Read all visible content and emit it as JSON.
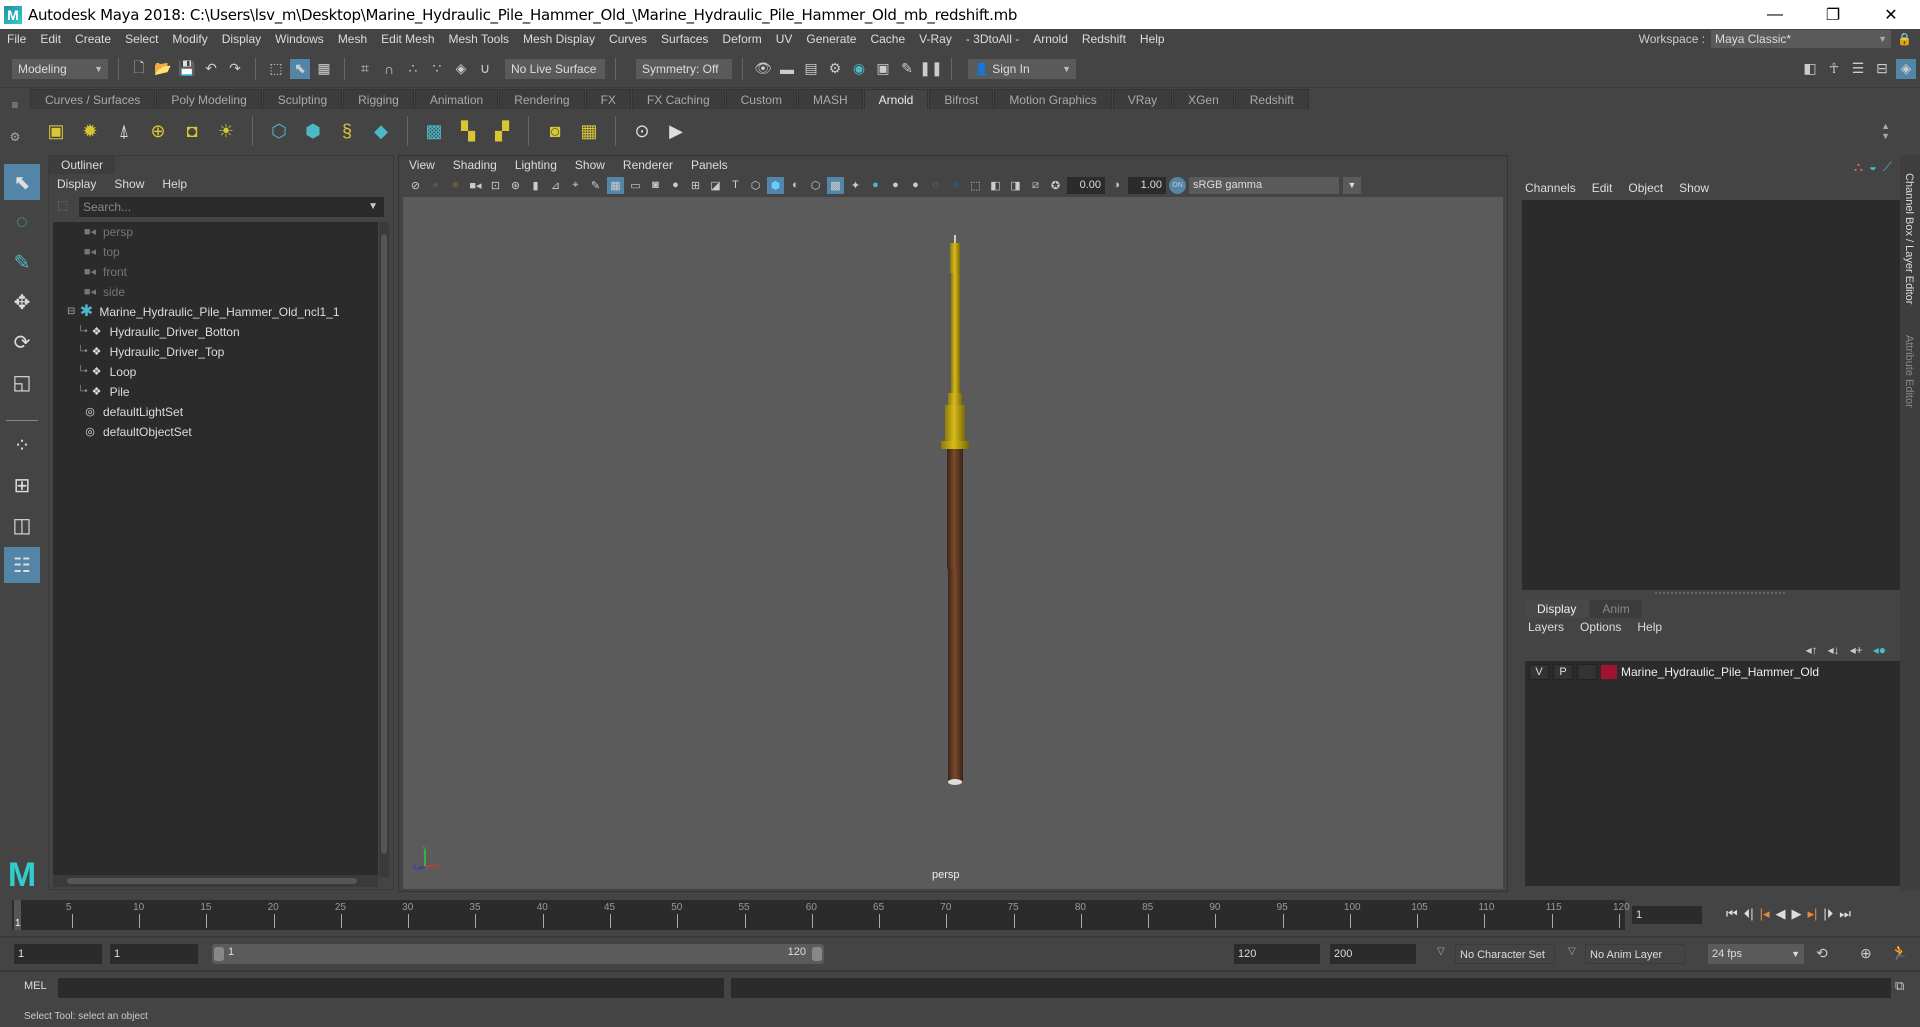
{
  "window": {
    "title": "Autodesk Maya 2018: C:\\Users\\lsv_m\\Desktop\\Marine_Hydraulic_Pile_Hammer_Old_\\Marine_Hydraulic_Pile_Hammer_Old_mb_redshift.mb",
    "logo": "M",
    "minimize": "—",
    "maximize": "❐",
    "close": "✕"
  },
  "menubar": {
    "items": [
      "File",
      "Edit",
      "Create",
      "Select",
      "Modify",
      "Display",
      "Windows",
      "Mesh",
      "Edit Mesh",
      "Mesh Tools",
      "Mesh Display",
      "Curves",
      "Surfaces",
      "Deform",
      "UV",
      "Generate",
      "Cache",
      "V-Ray",
      "- 3DtoAll -",
      "Arnold",
      "Redshift",
      "Help"
    ],
    "workspace_label": "Workspace :",
    "workspace_value": "Maya Classic*"
  },
  "statusline": {
    "mode": "Modeling",
    "live_surface": "No Live Surface",
    "symmetry": "Symmetry: Off",
    "sign_in": "Sign In"
  },
  "shelf": {
    "tabs": [
      "Curves / Surfaces",
      "Poly Modeling",
      "Sculpting",
      "Rigging",
      "Animation",
      "Rendering",
      "FX",
      "FX Caching",
      "Custom",
      "MASH",
      "Arnold",
      "Bifrost",
      "Motion Graphics",
      "VRay",
      "XGen",
      "Redshift"
    ],
    "active_tab": "Arnold"
  },
  "outliner": {
    "tab": "Outliner",
    "menus": [
      "Display",
      "Show",
      "Help"
    ],
    "search_placeholder": "Search...",
    "nodes": [
      {
        "label": "persp",
        "type": "camera"
      },
      {
        "label": "top",
        "type": "camera"
      },
      {
        "label": "front",
        "type": "camera"
      },
      {
        "label": "side",
        "type": "camera"
      },
      {
        "label": "Marine_Hydraulic_Pile_Hammer_Old_ncl1_1",
        "type": "group",
        "expanded": true
      },
      {
        "label": "Hydraulic_Driver_Botton",
        "type": "mesh",
        "child": true
      },
      {
        "label": "Hydraulic_Driver_Top",
        "type": "mesh",
        "child": true
      },
      {
        "label": "Loop",
        "type": "mesh",
        "child": true
      },
      {
        "label": "Pile",
        "type": "mesh",
        "child": true
      },
      {
        "label": "defaultLightSet",
        "type": "set"
      },
      {
        "label": "defaultObjectSet",
        "type": "set"
      }
    ]
  },
  "viewport": {
    "menus": [
      "View",
      "Shading",
      "Lighting",
      "Show",
      "Renderer",
      "Panels"
    ],
    "exposure": "0.00",
    "gamma": "1.00",
    "color_mgmt": "sRGB gamma",
    "camera_label": "persp",
    "axis": {
      "x": "x",
      "y": "y",
      "z": "z"
    }
  },
  "channel_box": {
    "menus": [
      "Channels",
      "Edit",
      "Object",
      "Show"
    ],
    "layer_tabs": [
      "Display",
      "Anim"
    ],
    "active_layer_tab": "Display",
    "layer_menus": [
      "Layers",
      "Options",
      "Help"
    ],
    "layers": [
      {
        "v": "V",
        "p": "P",
        "name": "Marine_Hydraulic_Pile_Hammer_Old",
        "color": "#a3122e"
      }
    ],
    "side_tabs": [
      "Channel Box / Layer Editor",
      "Attribute Editor"
    ]
  },
  "timeline": {
    "ticks": [
      5,
      10,
      15,
      20,
      25,
      30,
      35,
      40,
      45,
      50,
      55,
      60,
      65,
      70,
      75,
      80,
      85,
      90,
      95,
      100,
      105,
      110,
      115,
      120
    ],
    "start": 1,
    "end": 120,
    "current_frame": "1",
    "current_marker": "1"
  },
  "range": {
    "start_field": "1",
    "playback_start": "1",
    "slider_start": "1",
    "slider_end": "120",
    "playback_end": "120",
    "end_field": "200",
    "character_set": "No Character Set",
    "anim_layer": "No Anim Layer",
    "fps": "24 fps"
  },
  "command_line": {
    "label": "MEL"
  },
  "help_line": {
    "text": "Select Tool: select an object"
  }
}
